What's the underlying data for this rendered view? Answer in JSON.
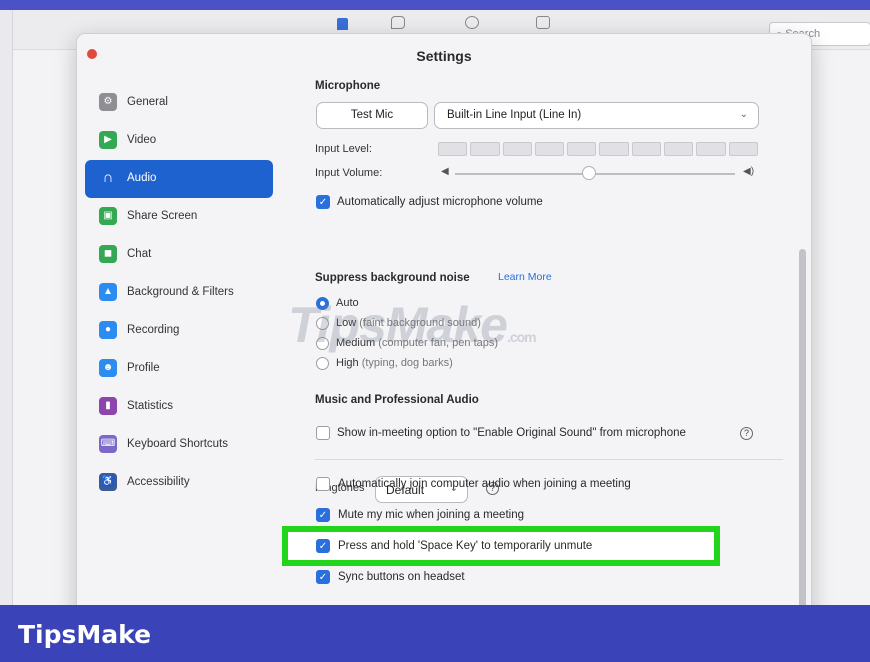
{
  "background_app": {
    "search_placeholder": "Search"
  },
  "window": {
    "title": "Settings"
  },
  "sidebar": {
    "items": [
      {
        "label": "General",
        "icon": "gear-icon",
        "color": "#8e8e93",
        "glyph": "⚙"
      },
      {
        "label": "Video",
        "icon": "video-icon",
        "color": "#34a853",
        "glyph": "▶"
      },
      {
        "label": "Audio",
        "icon": "headphones-icon",
        "color": "#1e62d0",
        "glyph": "∩",
        "active": true
      },
      {
        "label": "Share Screen",
        "icon": "share-screen-icon",
        "color": "#34a853",
        "glyph": "▣"
      },
      {
        "label": "Chat",
        "icon": "chat-icon",
        "color": "#34a853",
        "glyph": "◼"
      },
      {
        "label": "Background & Filters",
        "icon": "background-icon",
        "color": "#2d8cf0",
        "glyph": "▲"
      },
      {
        "label": "Recording",
        "icon": "recording-icon",
        "color": "#2d8cf0",
        "glyph": "●"
      },
      {
        "label": "Profile",
        "icon": "profile-icon",
        "color": "#2d8cf0",
        "glyph": "☻"
      },
      {
        "label": "Statistics",
        "icon": "statistics-icon",
        "color": "#8e44ad",
        "glyph": "▮"
      },
      {
        "label": "Keyboard Shortcuts",
        "icon": "keyboard-icon",
        "color": "#7b68c8",
        "glyph": "⌨"
      },
      {
        "label": "Accessibility",
        "icon": "accessibility-icon",
        "color": "#3a5a9a",
        "glyph": "♿"
      }
    ]
  },
  "audio": {
    "microphone": {
      "heading": "Microphone",
      "test_button": "Test Mic",
      "device": "Built-in Line Input (Line In)",
      "input_level_label": "Input Level:",
      "input_volume_label": "Input Volume:",
      "input_volume": 0.48,
      "auto_adjust": {
        "label": "Automatically adjust microphone volume",
        "checked": true
      }
    },
    "suppress": {
      "heading": "Suppress background noise",
      "learn_more": "Learn More",
      "options": [
        {
          "label": "Auto",
          "hint": "",
          "selected": true
        },
        {
          "label": "Low",
          "hint": "(faint background sound)",
          "selected": false
        },
        {
          "label": "Medium",
          "hint": "(computer fan, pen taps)",
          "selected": false
        },
        {
          "label": "High",
          "hint": "(typing, dog barks)",
          "selected": false
        }
      ]
    },
    "music": {
      "heading": "Music and Professional Audio",
      "original_sound": {
        "label": "Show in-meeting option to \"Enable Original Sound\" from microphone",
        "checked": false
      }
    },
    "ringtones": {
      "label": "Ringtones",
      "value": "Default"
    },
    "options": [
      {
        "label": "Automatically join computer audio when joining a meeting",
        "checked": false
      },
      {
        "label": "Mute my mic when joining a meeting",
        "checked": true
      },
      {
        "label": "Press and hold 'Space Key' to temporarily unmute",
        "checked": true
      },
      {
        "label": "Sync buttons on headset",
        "checked": true
      }
    ]
  },
  "watermark": {
    "text": "TipsMake",
    "suffix": ".com"
  },
  "brand": {
    "text": "TipsMake"
  },
  "colors": {
    "accent": "#1e62d0",
    "highlight": "#22d41a",
    "brand_bar": "#3a43b7"
  }
}
